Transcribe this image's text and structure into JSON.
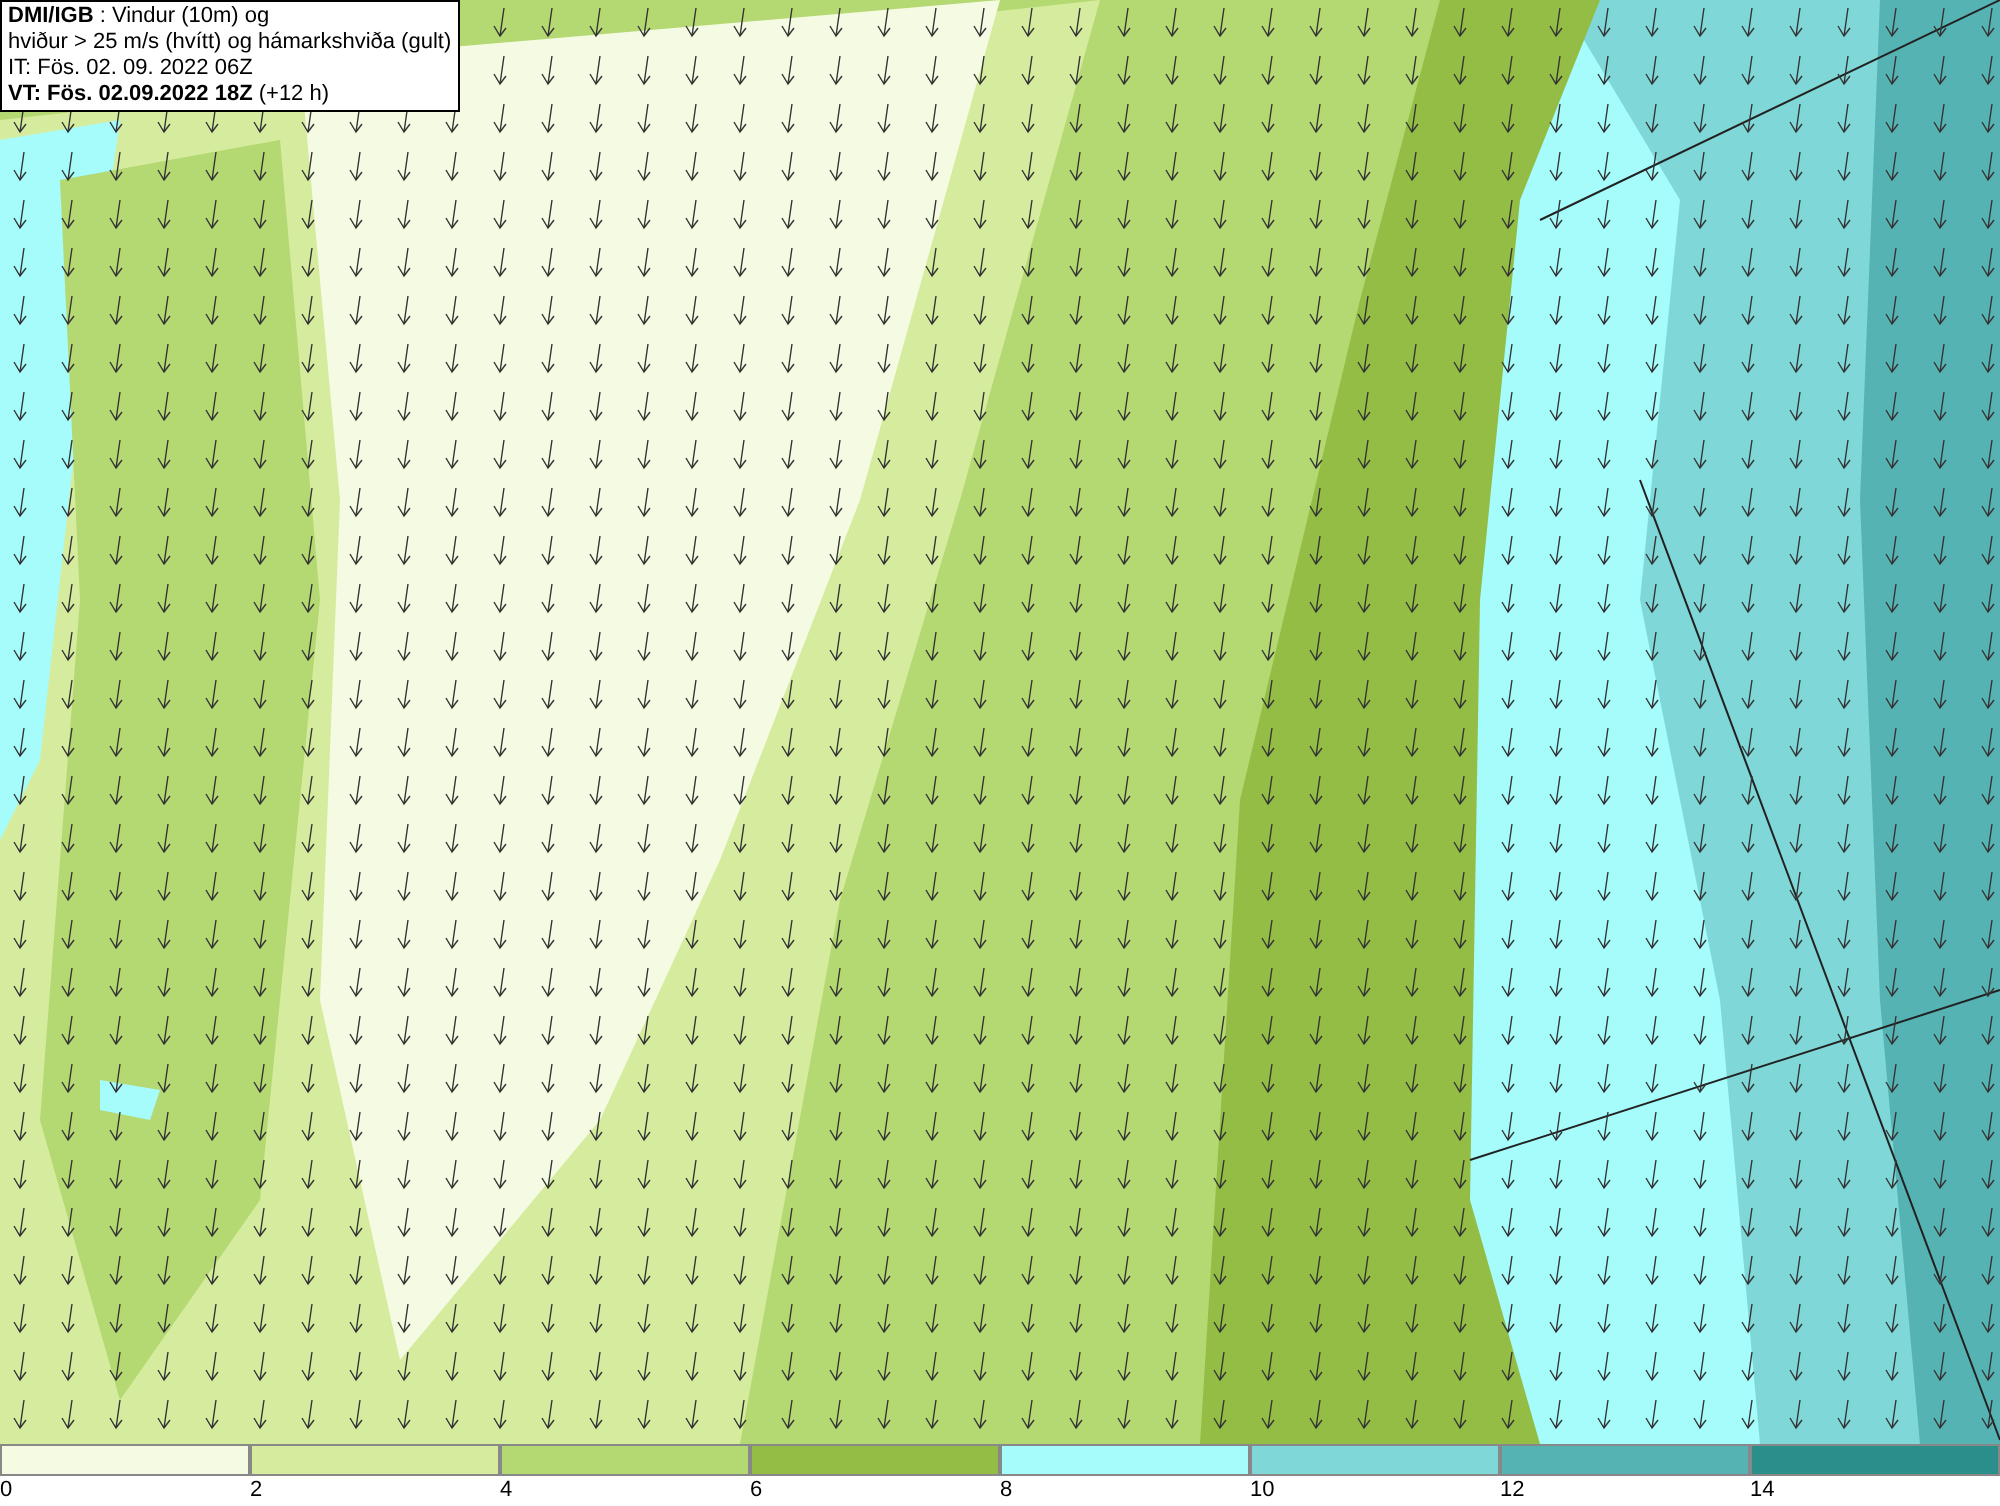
{
  "title_box": {
    "lines": [
      "**DMI/IGB** : Vindur (10m) og",
      "hviður > 25 m/s (hvítt) og hámarkshviða (gult)",
      "IT: Fös. 02. 09. 2022 06Z",
      "**VT: Fös. 02.09.2022 18Z** (+12 h)"
    ]
  },
  "legend": [
    {
      "label": "0",
      "color": "#f5fbe3"
    },
    {
      "label": "2",
      "color": "#d5ec9e"
    },
    {
      "label": "4",
      "color": "#b4d872"
    },
    {
      "label": "6",
      "color": "#93bd45"
    },
    {
      "label": "8",
      "color": "#a6fbfb"
    },
    {
      "label": "10",
      "color": "#7fd7d7"
    },
    {
      "label": "12",
      "color": "#56b3b3"
    },
    {
      "label": "14",
      "color": "#2a8f8a"
    }
  ]
}
